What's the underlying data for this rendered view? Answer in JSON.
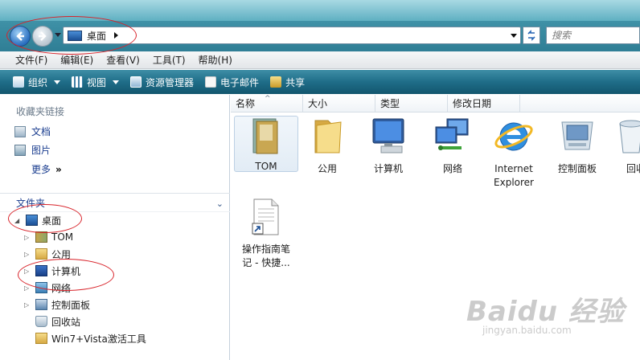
{
  "address": {
    "location": "桌面",
    "search_placeholder": "搜索"
  },
  "menu": {
    "items": [
      "文件(F)",
      "编辑(E)",
      "查看(V)",
      "工具(T)",
      "帮助(H)"
    ]
  },
  "commands": {
    "organize": "组织",
    "views": "视图",
    "explorer": "资源管理器",
    "email": "电子邮件",
    "share": "共享"
  },
  "sidebar": {
    "favorites_header": "收藏夹链接",
    "favorites": [
      "文档",
      "图片"
    ],
    "more": "更多",
    "folders_header": "文件夹",
    "tree": [
      "桌面",
      "TOM",
      "公用",
      "计算机",
      "网络",
      "控制面板",
      "回收站",
      "Win7+Vista激活工具"
    ]
  },
  "columns": [
    "名称",
    "大小",
    "类型",
    "修改日期"
  ],
  "files": [
    {
      "name": "TOM",
      "icon": "user-folder-icon",
      "selected": true
    },
    {
      "name": "公用",
      "icon": "folder-icon"
    },
    {
      "name": "计算机",
      "icon": "computer-icon"
    },
    {
      "name": "网络",
      "icon": "network-icon"
    },
    {
      "name_line1": "Internet",
      "name_line2": "Explorer",
      "icon": "ie-icon"
    },
    {
      "name": "控制面板",
      "icon": "control-panel-icon"
    },
    {
      "name": "回收",
      "icon": "recycle-bin-icon"
    },
    {
      "name_line1": "操作指南笔",
      "name_line2": "记 - 快捷...",
      "icon": "shortcut-document-icon"
    }
  ],
  "watermark": {
    "main": "Baidu 经验",
    "sub": "jingyan.baidu.com"
  },
  "colors": {
    "command_bar": "#1f6d88",
    "link": "#1a3d8f",
    "annotation": "#d8232a"
  }
}
